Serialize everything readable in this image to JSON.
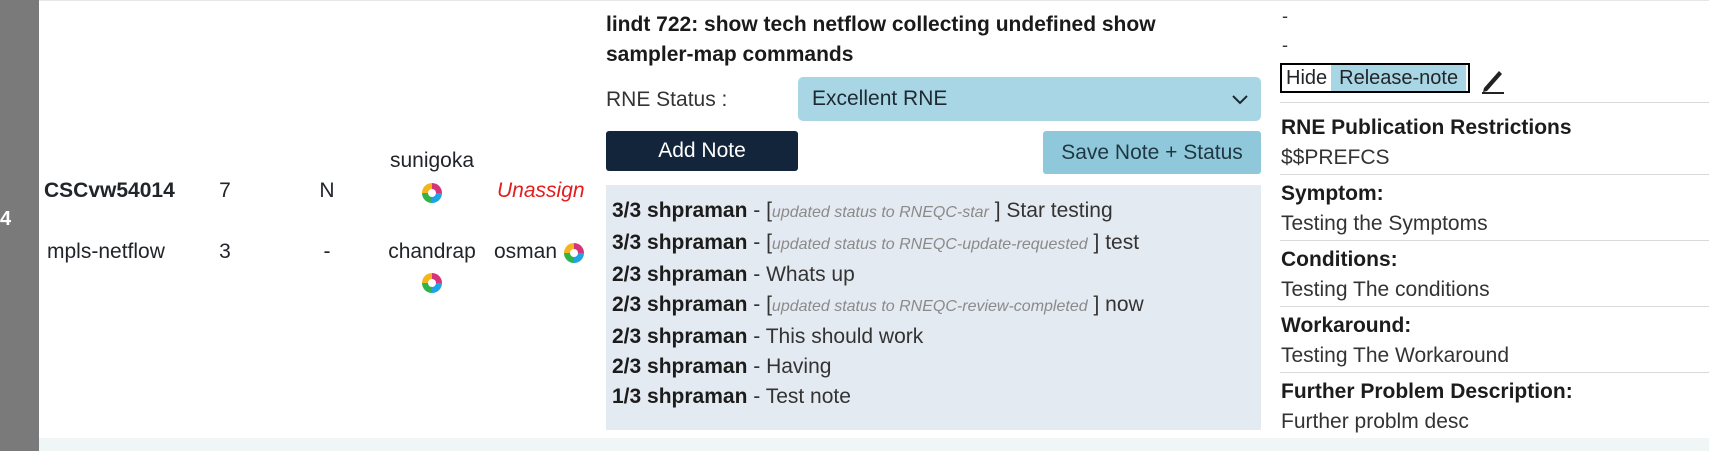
{
  "row_index": "4",
  "row": {
    "bug_id": "CSCvw54014",
    "component": "mpls-netflow",
    "count1": "7",
    "count2": "3",
    "flag1": "N",
    "flag2": "-",
    "user1": "sunigoka",
    "user2": "chandrap",
    "unassign_label": "Unassign",
    "assignee": "osman"
  },
  "headline": "lindt 722: show tech netflow collecting undefined show sampler-map commands",
  "rne": {
    "label": "RNE Status :",
    "selected": "Excellent RNE"
  },
  "buttons": {
    "add_note": "Add Note",
    "save_note": "Save Note + Status"
  },
  "notes": [
    {
      "date": "3/3",
      "user": "shpraman",
      "status": "updated status to RNEQC-star",
      "text": "Star testing"
    },
    {
      "date": "3/3",
      "user": "shpraman",
      "status": "updated status to RNEQC-update-requested",
      "text": "test"
    },
    {
      "date": "2/3",
      "user": "shpraman",
      "status": "",
      "text": "Whats up"
    },
    {
      "date": "2/3",
      "user": "shpraman",
      "status": "updated status to RNEQC-review-completed",
      "text": "now"
    },
    {
      "date": "2/3",
      "user": "shpraman",
      "status": "",
      "text": "This should work"
    },
    {
      "date": "2/3",
      "user": "shpraman",
      "status": "",
      "text": "Having"
    },
    {
      "date": "1/3",
      "user": "shpraman",
      "status": "",
      "text": "Test note"
    }
  ],
  "release_note": {
    "dash1": "-",
    "dash2": "-",
    "hide_label": "Hide",
    "release_note_label": "Release-note",
    "restrictions_title": "RNE Publication Restrictions",
    "restrictions_value": "$$PREFCS",
    "symptom_title": "Symptom:",
    "symptom_value": "Testing the Symptoms",
    "conditions_title": "Conditions:",
    "conditions_value": "Testing The conditions",
    "workaround_title": "Workaround:",
    "workaround_value": "Testing The Workaround",
    "further_title": "Further Problem Description:",
    "further_value": "Further problm desc"
  },
  "colors": {
    "accent_select": "#a9d6e5",
    "add_button": "#13253a",
    "unassign": "#e31d1d",
    "notes_bg": "#e4eaf1"
  }
}
